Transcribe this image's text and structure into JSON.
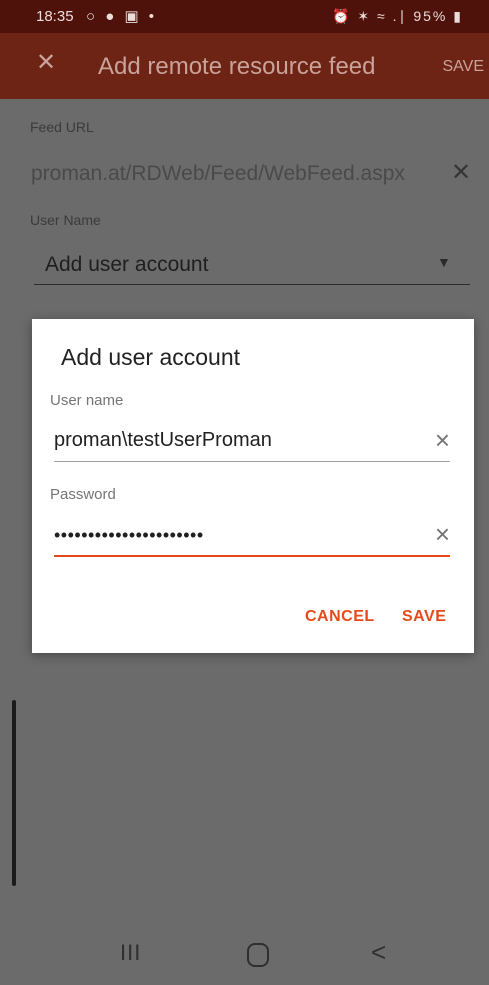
{
  "status_bar": {
    "time": "18:35",
    "left_icons": "○ ● ▣ •",
    "right_icons": "⏰ ✶ ≈ .∣",
    "battery": "95%"
  },
  "app_bar": {
    "title": "Add remote resource feed",
    "save_label": "SAVE",
    "close_icon": "close-icon"
  },
  "form": {
    "feed_url_label": "Feed URL",
    "feed_url_value": "proman.at/RDWeb/Feed/WebFeed.aspx",
    "user_name_label": "User Name",
    "user_name_selected": "Add user account"
  },
  "dialog": {
    "title": "Add user account",
    "username_label": "User name",
    "username_value": "proman\\testUserProman",
    "password_label": "Password",
    "password_value": "••••••••••••••••••••••",
    "cancel_label": "CANCEL",
    "save_label": "SAVE"
  },
  "nav_bar": {
    "recent_icon": "III",
    "back_icon": "<"
  },
  "colors": {
    "status_bar": "#4f120a",
    "app_bar": "#6e2415",
    "accent": "#e64a19",
    "scrim": "#6b6b6b"
  }
}
